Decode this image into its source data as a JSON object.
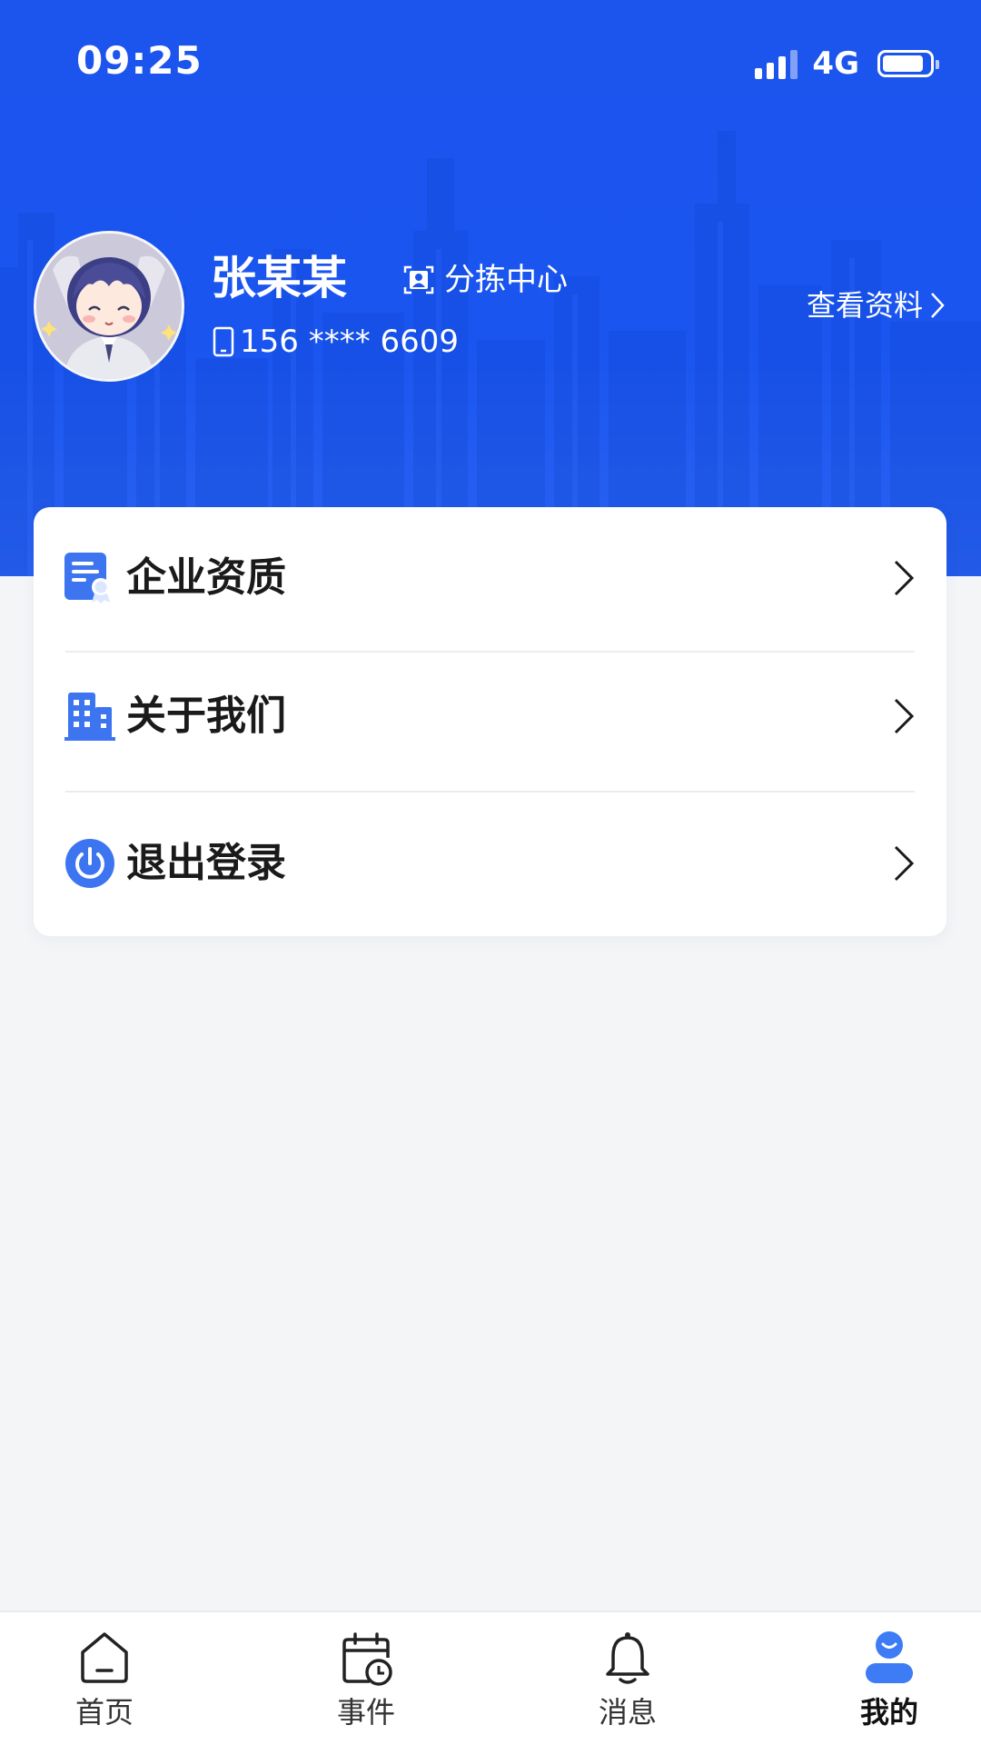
{
  "status_bar": {
    "time": "09:25",
    "network": "4G"
  },
  "profile": {
    "name": "张某某",
    "role": "分拣中心",
    "phone": "156 **** 6609",
    "view_profile_label": "查看资料"
  },
  "menu": {
    "items": [
      {
        "label": "企业资质",
        "icon": "certificate-icon"
      },
      {
        "label": "关于我们",
        "icon": "building-icon"
      },
      {
        "label": "退出登录",
        "icon": "power-icon"
      }
    ]
  },
  "tabbar": {
    "tabs": [
      {
        "label": "首页",
        "icon": "home-icon",
        "active": false
      },
      {
        "label": "事件",
        "icon": "calendar-clock-icon",
        "active": false
      },
      {
        "label": "消息",
        "icon": "bell-icon",
        "active": false
      },
      {
        "label": "我的",
        "icon": "user-icon",
        "active": true
      }
    ]
  },
  "colors": {
    "primary": "#1a55f0",
    "page_bg": "#f4f5f7",
    "icon_blue": "#3d74f0"
  }
}
